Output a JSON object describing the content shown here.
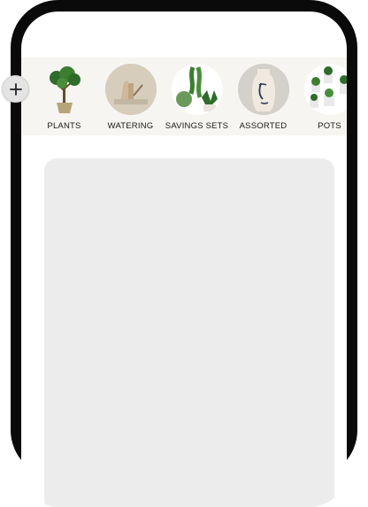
{
  "categories": [
    {
      "label": "PLANTS",
      "icon": "bonsai-tree-icon"
    },
    {
      "label": "WATERING",
      "icon": "watering-can-icon"
    },
    {
      "label": "SAVINGS SETS",
      "icon": "plant-set-icon"
    },
    {
      "label": "ASSORTED",
      "icon": "face-vase-icon"
    },
    {
      "label": "POTS",
      "icon": "potted-succulents-icon"
    }
  ],
  "add_button": {
    "icon": "plus-icon"
  },
  "colors": {
    "frame": "#0a0a0a",
    "strip": "#f7f5f1",
    "placeholder": "#ececec"
  }
}
